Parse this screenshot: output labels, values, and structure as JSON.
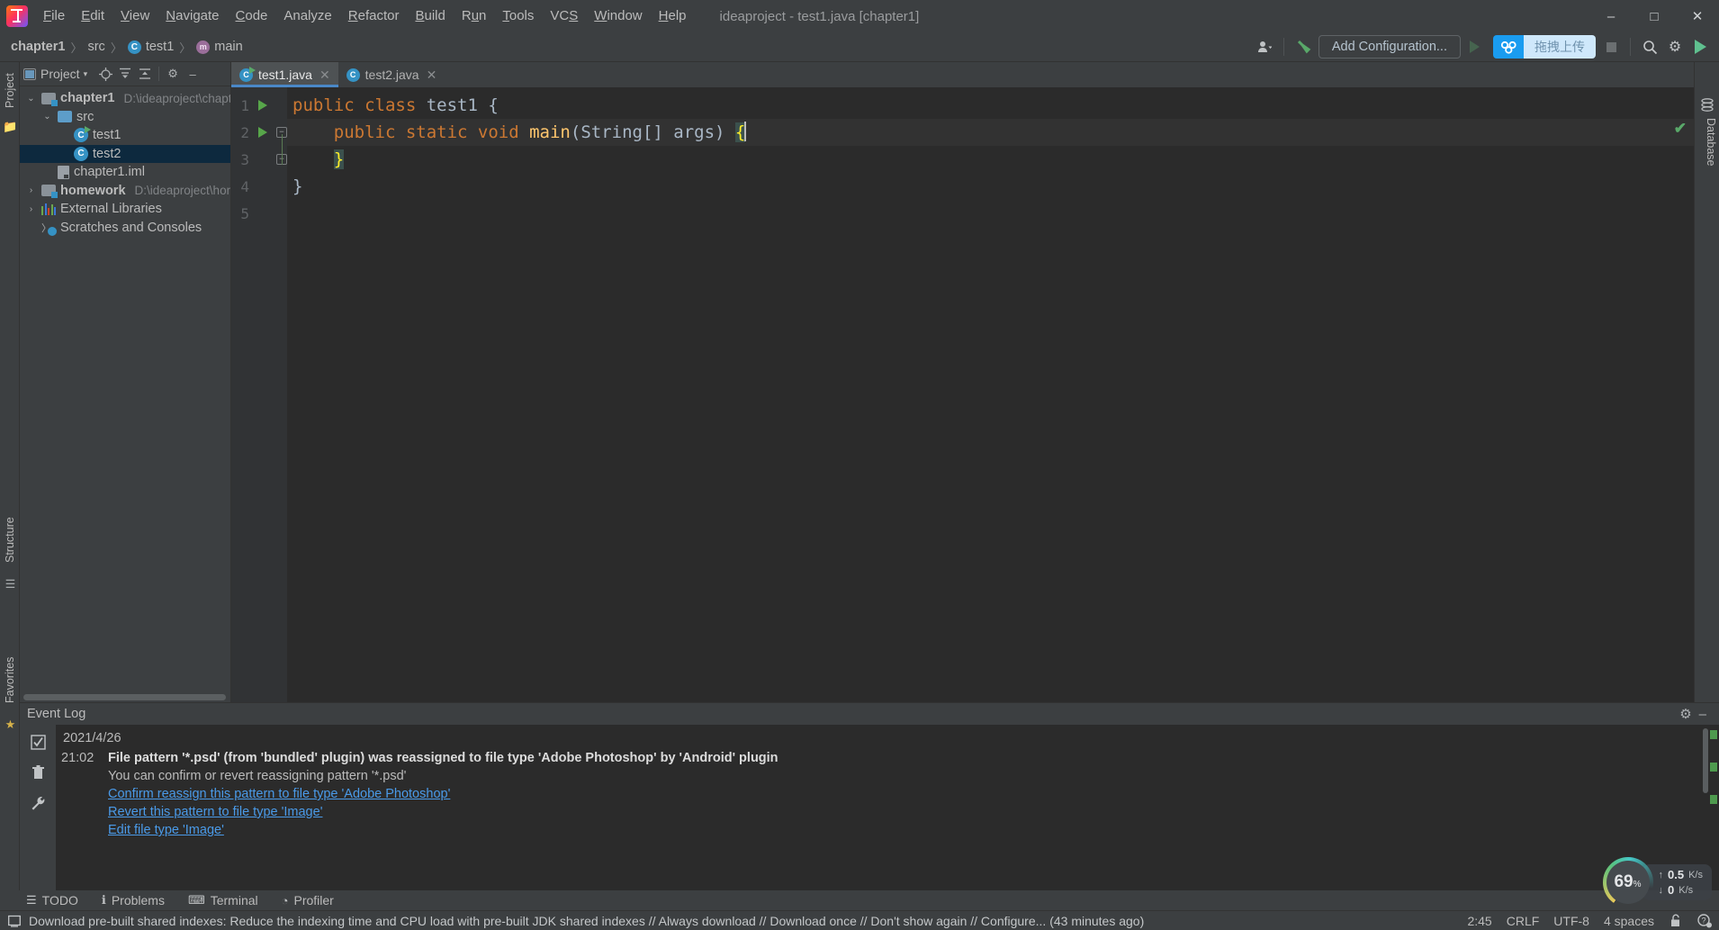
{
  "window": {
    "title": "ideaproject - test1.java [chapter1]",
    "minimize_icon": "minimize-icon",
    "maximize_icon": "maximize-icon",
    "close_icon": "close-icon"
  },
  "menu": {
    "items": [
      "File",
      "Edit",
      "View",
      "Navigate",
      "Code",
      "Analyze",
      "Refactor",
      "Build",
      "Run",
      "Tools",
      "VCS",
      "Window",
      "Help"
    ]
  },
  "breadcrumb": {
    "items": [
      {
        "label": "chapter1",
        "icon": "none",
        "bold": true
      },
      {
        "label": "src",
        "icon": "none",
        "bold": false
      },
      {
        "label": "test1",
        "icon": "class-icon",
        "glyph": "C",
        "bold": false
      },
      {
        "label": "main",
        "icon": "method-icon",
        "glyph": "m",
        "bold": false
      }
    ],
    "separator": "〉"
  },
  "toolbar": {
    "profile_icon": "user-profile-icon",
    "hammer_icon": "build-hammer-icon",
    "add_configuration": "Add Configuration...",
    "run_icon": "run-icon",
    "netdisk_label": "拖拽上传",
    "netdisk_icon": "baidu-netdisk-icon",
    "stop_icon": "stop-icon",
    "search_icon": "search-icon",
    "settings_icon": "gear-icon",
    "play_icon": "play-icon"
  },
  "left_rail": {
    "project_label": "Project",
    "structure_label": "Structure",
    "favorites_label": "Favorites",
    "bookmark_icon": "bookmark-icon",
    "star_icon": "star-icon",
    "folder_icon": "folder-icon"
  },
  "right_rail": {
    "database_label": "Database",
    "database_icon": "database-icon"
  },
  "project_panel": {
    "title": "Project",
    "caret": "▾",
    "icons": [
      "locate-icon",
      "expand-all-icon",
      "collapse-all-icon",
      "gear-icon",
      "hide-icon"
    ],
    "tree": [
      {
        "label": "chapter1",
        "path": "D:\\ideaproject\\chapte",
        "icon": "module-icon",
        "arrow": "⌄",
        "indent": 0,
        "bold": true,
        "selected": false
      },
      {
        "label": "src",
        "path": "",
        "icon": "folder-icon",
        "arrow": "⌄",
        "indent": 1,
        "bold": false,
        "selected": false
      },
      {
        "label": "test1",
        "path": "",
        "icon": "runnable-class-icon",
        "glyph": "C",
        "arrow": "",
        "indent": 2,
        "bold": false,
        "selected": false
      },
      {
        "label": "test2",
        "path": "",
        "icon": "class-icon",
        "glyph": "C",
        "arrow": "",
        "indent": 2,
        "bold": false,
        "selected": true
      },
      {
        "label": "chapter1.iml",
        "path": "",
        "icon": "iml-file-icon",
        "arrow": "",
        "indent": 1,
        "bold": false,
        "selected": false
      },
      {
        "label": "homework",
        "path": "D:\\ideaproject\\hom",
        "icon": "module-icon",
        "arrow": "›",
        "indent": 0,
        "bold": true,
        "selected": false
      },
      {
        "label": "External Libraries",
        "path": "",
        "icon": "libraries-icon",
        "arrow": "›",
        "indent": 0,
        "bold": false,
        "selected": false
      },
      {
        "label": "Scratches and Consoles",
        "path": "",
        "icon": "scratches-icon",
        "arrow": "",
        "indent": 0,
        "bold": false,
        "selected": false
      }
    ]
  },
  "editor": {
    "tabs": [
      {
        "label": "test1.java",
        "icon": "runnable-class-icon",
        "glyph": "C",
        "active": true,
        "close": "✕"
      },
      {
        "label": "test2.java",
        "icon": "class-icon",
        "glyph": "C",
        "active": false,
        "close": "✕"
      }
    ],
    "inspection_status": "✔",
    "lines": [
      {
        "num": "1",
        "runnable": true,
        "fold": false,
        "current": false,
        "segments": [
          {
            "t": "public class ",
            "c": "kw"
          },
          {
            "t": "test1",
            "c": "cls"
          },
          {
            "t": " {",
            "c": "cls"
          }
        ]
      },
      {
        "num": "2",
        "runnable": true,
        "fold": true,
        "current": true,
        "segments": [
          {
            "t": "    public static void ",
            "c": "kw"
          },
          {
            "t": "main",
            "c": "mth"
          },
          {
            "t": "(String[] args) ",
            "c": "cls"
          },
          {
            "t": "{",
            "c": "brace-hl"
          }
        ]
      },
      {
        "num": "3",
        "runnable": false,
        "fold": true,
        "current": false,
        "segments": [
          {
            "t": "    ",
            "c": "cls"
          },
          {
            "t": "}",
            "c": "brace-hl"
          }
        ]
      },
      {
        "num": "4",
        "runnable": false,
        "fold": false,
        "current": false,
        "segments": [
          {
            "t": "}",
            "c": "cls"
          }
        ]
      },
      {
        "num": "5",
        "runnable": false,
        "fold": false,
        "current": false,
        "segments": []
      }
    ]
  },
  "event_log": {
    "title": "Event Log",
    "settings_icon": "gear-icon",
    "hide_icon": "hide-icon",
    "side_buttons": [
      "mark-read-icon",
      "trash-icon",
      "wrench-icon"
    ],
    "date": "2021/4/26",
    "entry": {
      "time": "21:02",
      "message": "File pattern '*.psd' (from 'bundled' plugin) was reassigned to file type 'Adobe Photoshop' by 'Android' plugin",
      "detail": "You can confirm or revert reassigning pattern '*.psd'",
      "links": [
        "Confirm reassign this pattern to file type 'Adobe Photoshop'",
        "Revert this pattern to file type 'Image'",
        "Edit file type 'Image'"
      ]
    }
  },
  "bottom_toolbar": {
    "items": [
      {
        "label": "TODO",
        "icon": "todo-list-icon"
      },
      {
        "label": "Problems",
        "icon": "problems-icon"
      },
      {
        "label": "Terminal",
        "icon": "terminal-icon"
      },
      {
        "label": "Profiler",
        "icon": "profiler-icon"
      }
    ]
  },
  "status_bar": {
    "icon": "notification-icon",
    "message": "Download pre-built shared indexes: Reduce the indexing time and CPU load with pre-built JDK shared indexes // Always download // Download once // Don't show again // Configure... (43 minutes ago)",
    "caret_position": "2:45",
    "line_separator": "CRLF",
    "encoding": "UTF-8",
    "indent": "4 spaces",
    "lock_icon": "unlock-icon",
    "help_icon": "help-icon"
  },
  "perf_widget": {
    "cpu_percent": "69",
    "percent_symbol": "%",
    "upload": "0.5",
    "upload_unit": "K/s",
    "download": "0",
    "download_unit": "K/s",
    "up_arrow": "↑",
    "down_arrow": "↓"
  },
  "colors": {
    "bg": "#3c3f41",
    "editor_bg": "#2b2b2b",
    "accent_blue": "#4a88c7",
    "keyword_orange": "#cc7832",
    "method_yellow": "#ffc66d",
    "text": "#a9b7c6",
    "link": "#4a9ae8",
    "green": "#59a869",
    "netdisk_blue": "#1a9cf0"
  }
}
